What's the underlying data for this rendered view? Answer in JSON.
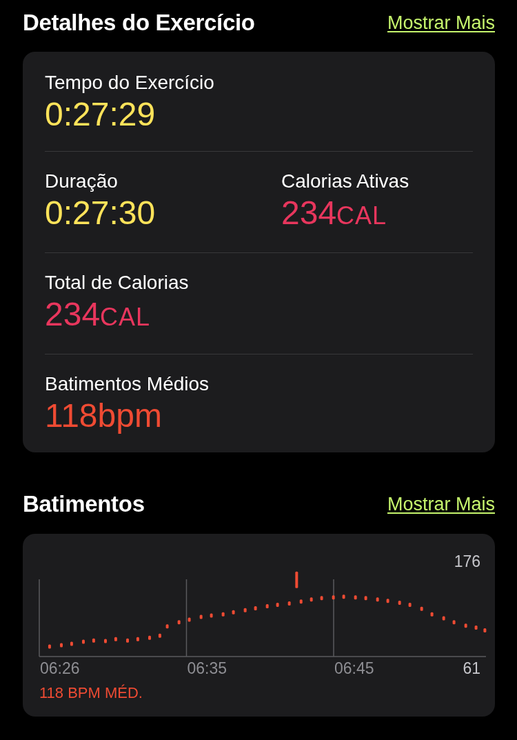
{
  "details": {
    "title": "Detalhes do Exercício",
    "link": "Mostrar Mais",
    "rows": [
      {
        "metrics": [
          {
            "label": "Tempo do Exercício",
            "value": "0:27:29",
            "color": "#ffe35a"
          }
        ]
      },
      {
        "metrics": [
          {
            "label": "Duração",
            "value": "0:27:30",
            "color": "#ffe35a"
          },
          {
            "label": "Calorias Ativas",
            "value": "234",
            "unit": "CAL",
            "color": "#e8365d"
          }
        ]
      },
      {
        "metrics": [
          {
            "label": "Total de Calorias",
            "value": "234",
            "unit": "CAL",
            "color": "#e8365d"
          }
        ]
      },
      {
        "metrics": [
          {
            "label": "Batimentos Médios",
            "value": "118",
            "unit": "bpm",
            "color": "#ef4b33"
          }
        ]
      }
    ]
  },
  "heart_rate": {
    "title": "Batimentos",
    "link": "Mostrar Mais",
    "max_label": "176",
    "min_label": "61",
    "time_labels": [
      "06:26",
      "06:35",
      "06:45"
    ],
    "average": "118 BPM MÉD."
  }
}
